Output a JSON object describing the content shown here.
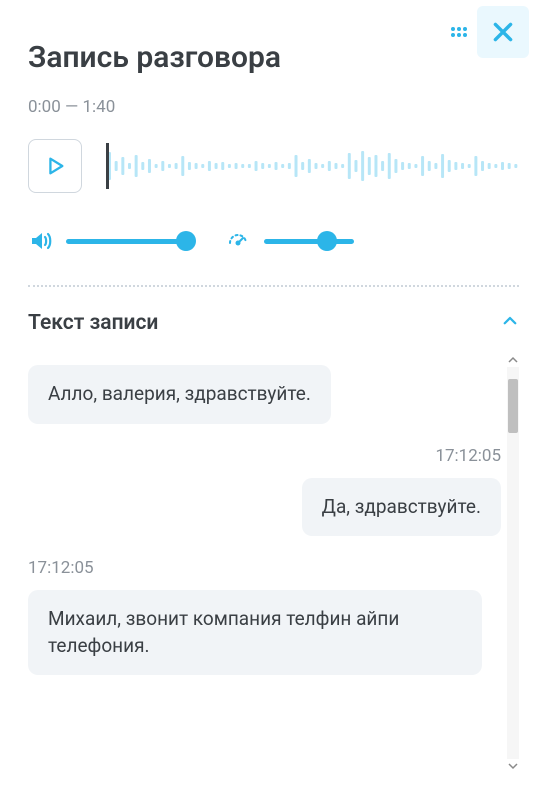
{
  "header": {
    "title": "Запись разговора",
    "time_range": "0:00 — 1:40"
  },
  "player": {
    "playhead_position": 0,
    "waveform_bars": [
      28,
      10,
      18,
      6,
      22,
      8,
      14,
      4,
      10,
      4,
      6,
      20,
      8,
      6,
      4,
      10,
      6,
      8,
      4,
      6,
      4,
      4,
      10,
      6,
      4,
      8,
      4,
      6,
      22,
      8,
      14,
      6,
      4,
      10,
      6,
      4,
      26,
      12,
      30,
      18,
      22,
      10,
      26,
      14,
      8,
      6,
      4,
      20,
      10,
      6,
      24,
      12,
      8,
      6,
      4,
      20,
      10,
      6,
      4,
      8,
      6,
      4
    ],
    "waveform_color": "#b7e6f7"
  },
  "controls": {
    "volume": {
      "min": 0,
      "max": 100,
      "value": 100,
      "track_width": 120
    },
    "speed": {
      "min": 0,
      "max": 100,
      "value": 70,
      "track_width": 90
    }
  },
  "transcript": {
    "title": "Текст записи",
    "expanded": true,
    "cut_timestamp": "17:12:05",
    "messages": [
      {
        "side": "left",
        "ts": null,
        "text": "Алло, валерия, здравствуйте."
      },
      {
        "side": "right",
        "ts": "17:12:05",
        "text": "Да, здравствуйте."
      },
      {
        "side": "left",
        "ts": "17:12:05",
        "text": "Михаил, звонит компания телфин айпи телефония."
      }
    ]
  },
  "colors": {
    "accent": "#2cb5e8"
  }
}
